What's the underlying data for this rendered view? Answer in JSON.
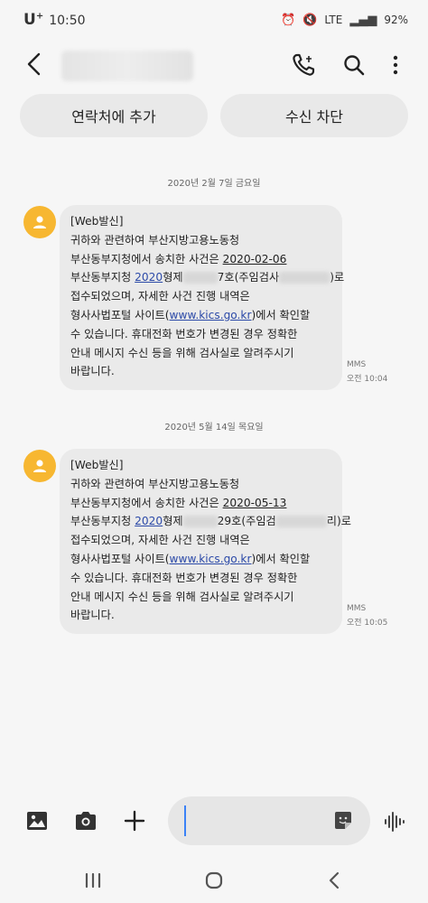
{
  "status": {
    "carrier": "U",
    "carrier_sup": "+",
    "time": "10:50",
    "network": "LTE",
    "battery": "92%"
  },
  "header": {
    "contact": "",
    "icons": [
      "back-icon",
      "phone-icon",
      "search-icon",
      "more-icon"
    ]
  },
  "actions": {
    "add_contact": "연락처에 추가",
    "block": "수신 차단"
  },
  "messages": [
    {
      "date": "2020년 2월 7일 금요일",
      "lines": [
        {
          "parts": [
            {
              "t": "[Web발신]"
            }
          ]
        },
        {
          "parts": [
            {
              "t": "귀하와 관련하여 부산지방고용노동청"
            }
          ]
        },
        {
          "parts": [
            {
              "t": "부산동부지청에서 송치한 사건은 "
            },
            {
              "t": "2020-02-06",
              "c": "num"
            }
          ]
        },
        {
          "parts": [
            {
              "t": "부산동부지청 "
            },
            {
              "t": "2020",
              "c": "link"
            },
            {
              "t": "형제"
            },
            {
              "t": "__",
              "c": "blur"
            },
            {
              "t": "7호(주임검사"
            },
            {
              "t": "____",
              "c": "blur wide"
            },
            {
              "t": ")로"
            }
          ]
        },
        {
          "parts": [
            {
              "t": "접수되었으며, 자세한 사건 진행 내역은"
            }
          ]
        },
        {
          "parts": [
            {
              "t": "형사사법포털 사이트("
            },
            {
              "t": "www.kics.go.kr",
              "c": "link"
            },
            {
              "t": ")에서 확인할"
            }
          ]
        },
        {
          "parts": [
            {
              "t": "수 있습니다. 휴대전화 번호가 변경된 경우 정확한"
            }
          ]
        },
        {
          "parts": [
            {
              "t": "안내 메시지 수신 등을 위해 검사실로 알려주시기"
            }
          ]
        },
        {
          "parts": [
            {
              "t": "바랍니다."
            }
          ]
        }
      ],
      "type": "MMS",
      "time": "오전 10:04"
    },
    {
      "date": "2020년 5월 14일 목요일",
      "lines": [
        {
          "parts": [
            {
              "t": "[Web발신]"
            }
          ]
        },
        {
          "parts": [
            {
              "t": "귀하와 관련하여 부산지방고용노동청"
            }
          ]
        },
        {
          "parts": [
            {
              "t": "부산동부지청에서 송치한 사건은 "
            },
            {
              "t": "2020-05-13",
              "c": "num"
            }
          ]
        },
        {
          "parts": [
            {
              "t": "부산동부지청 "
            },
            {
              "t": "2020",
              "c": "link"
            },
            {
              "t": "형제"
            },
            {
              "t": "__",
              "c": "blur"
            },
            {
              "t": "29호(주임검"
            },
            {
              "t": "____",
              "c": "blur wide"
            },
            {
              "t": "리)로"
            }
          ]
        },
        {
          "parts": [
            {
              "t": "접수되었으며, 자세한 사건 진행 내역은"
            }
          ]
        },
        {
          "parts": [
            {
              "t": "형사사법포털 사이트("
            },
            {
              "t": "www.kics.go.kr",
              "c": "link"
            },
            {
              "t": ")에서 확인할"
            }
          ]
        },
        {
          "parts": [
            {
              "t": "수 있습니다. 휴대전화 번호가 변경된 경우 정확한"
            }
          ]
        },
        {
          "parts": [
            {
              "t": "안내 메시지 수신 등을 위해 검사실로 알려주시기"
            }
          ]
        },
        {
          "parts": [
            {
              "t": "바랍니다."
            }
          ]
        }
      ],
      "type": "MMS",
      "time": "오전 10:05"
    }
  ],
  "composer": {
    "placeholder": ""
  }
}
